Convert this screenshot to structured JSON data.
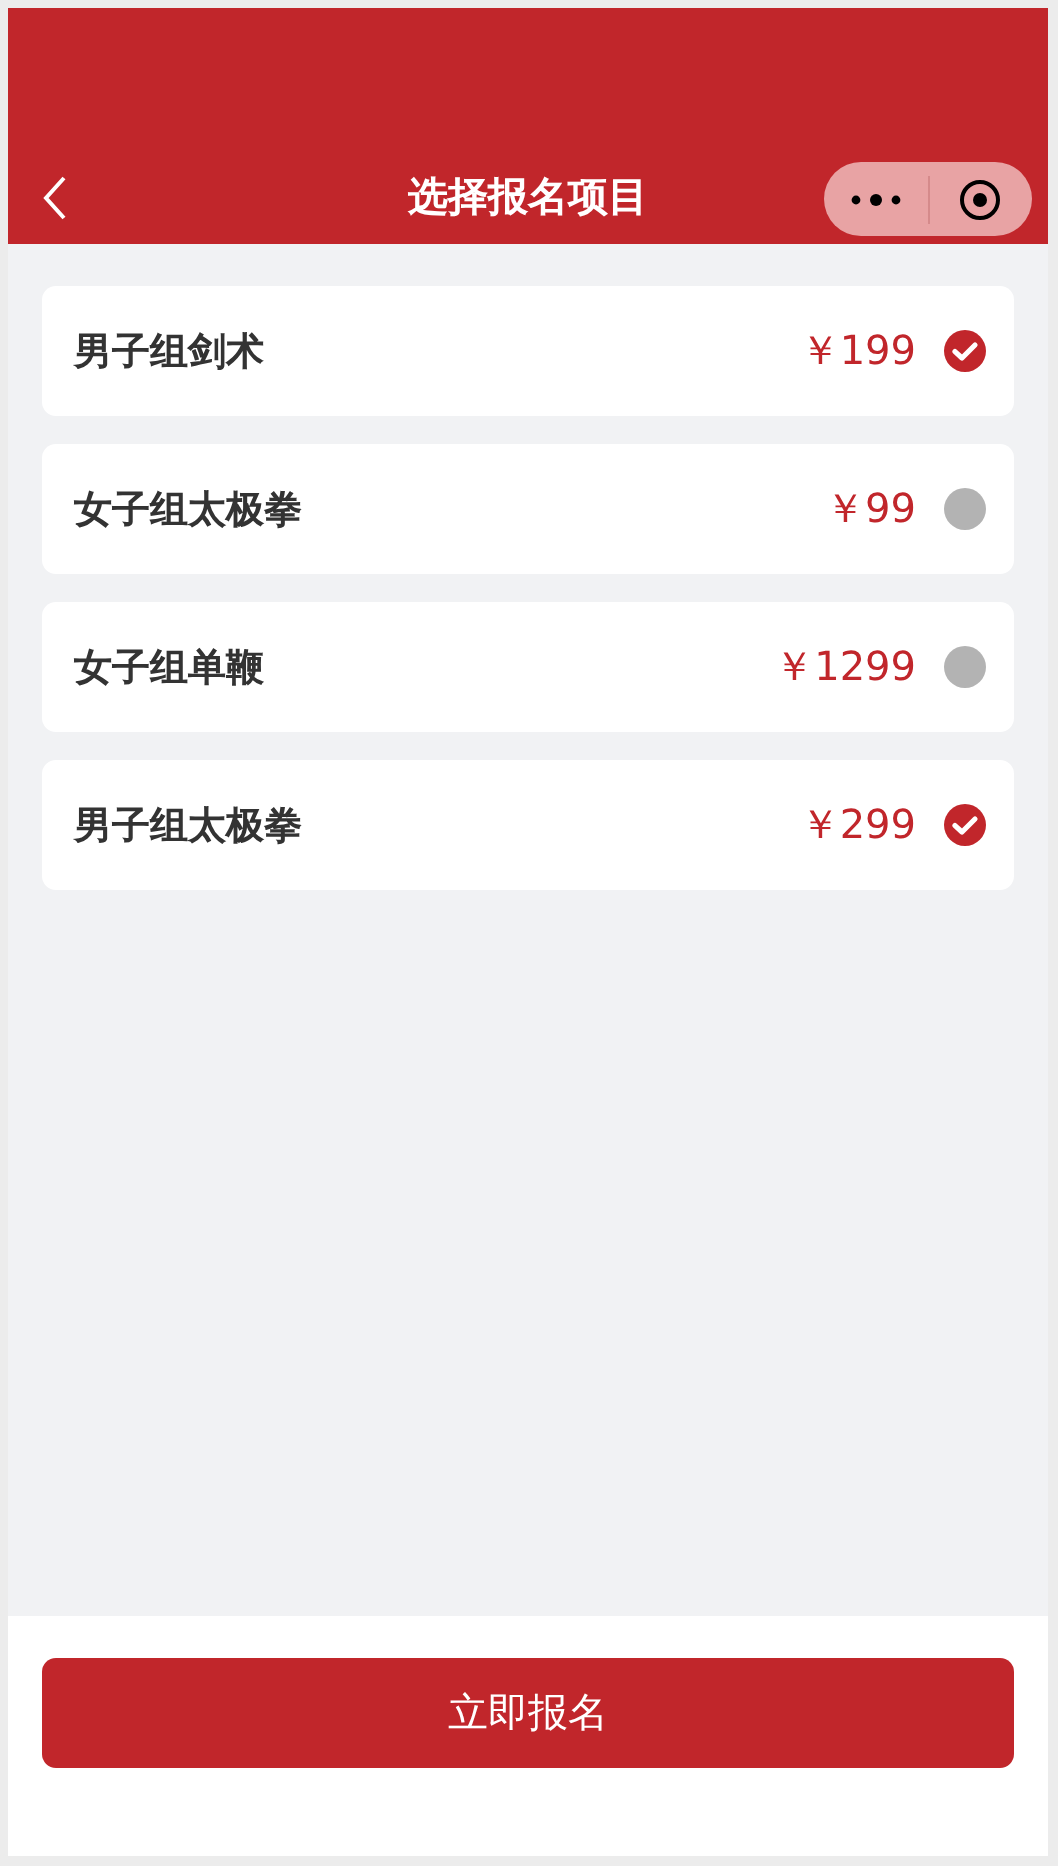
{
  "header": {
    "title": "选择报名项目"
  },
  "items": [
    {
      "name": "男子组剑术",
      "price": "￥199",
      "selected": true
    },
    {
      "name": "女子组太极拳",
      "price": "￥99",
      "selected": false
    },
    {
      "name": "女子组单鞭",
      "price": "￥1299",
      "selected": false
    },
    {
      "name": "男子组太极拳",
      "price": "￥299",
      "selected": true
    }
  ],
  "submit_button": "立即报名"
}
